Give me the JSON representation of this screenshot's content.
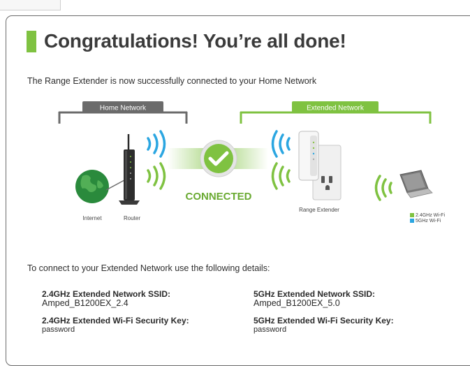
{
  "header": {
    "title": "Congratulations! You’re all done!",
    "subtitle": "The Range Extender is now successfully connected to your Home Network"
  },
  "diagram": {
    "home_network_label": "Home Network",
    "extended_network_label": "Extended Network",
    "internet_label": "Internet",
    "router_label": "Router",
    "connected_label": "CONNECTED",
    "extender_label": "Range Extender",
    "legend": [
      {
        "label": "2.4GHz Wi-Fi",
        "color": "#7fc241"
      },
      {
        "label": "5GHz Wi-Fi",
        "color": "#2ba6e1"
      }
    ],
    "colors": {
      "green": "#7fc241",
      "blue": "#2ba6e1",
      "gray": "#6b6b6b",
      "globe": "#2a8a3c"
    }
  },
  "details": {
    "intro": "To connect to your Extended Network use the following details:",
    "ssid24_label": "2.4GHz Extended Network SSID:",
    "ssid24_value": "Amped_B1200EX_2.4",
    "ssid5_label": "5GHz Extended Network SSID:",
    "ssid5_value": "Amped_B1200EX_5.0",
    "key24_label": "2.4GHz Extended Wi-Fi Security Key:",
    "key24_value": "password",
    "key5_label": "5GHz Extended Wi-Fi Security Key:",
    "key5_value": "password"
  }
}
